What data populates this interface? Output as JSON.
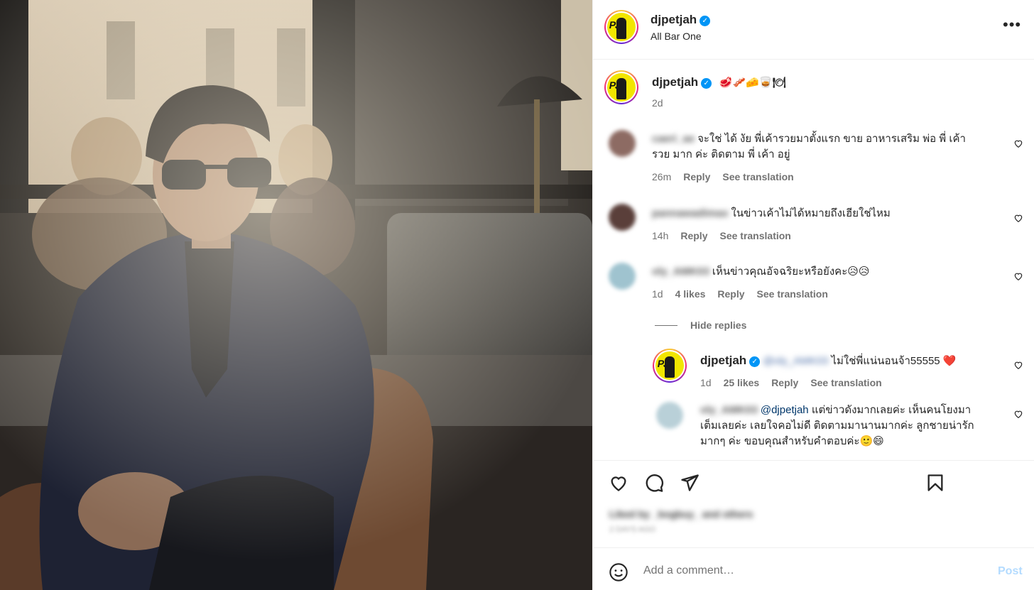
{
  "post": {
    "author": "djpetjah",
    "location": "All Bar One",
    "caption_emojis": "🥩🥓🧀🥃🍽",
    "caption_time": "2d"
  },
  "comments": [
    {
      "username_blurred": "caeri_ae",
      "text": "จะใช่ ได้ งัย พี่เค้ารวยมาตั้งแรก ขาย อาหารเสริม พ่อ พี่ เค้า",
      "text2": "รวย มาก ค่ะ ติดตาม พี่ เค้า อยู่",
      "time": "26m",
      "reply": "Reply",
      "translate": "See translation"
    },
    {
      "username_blurred": "pannawadimax",
      "text": "ในข่าวเค้าไม่ได้หมายถึงเฮียใช่ไหม",
      "time": "14h",
      "reply": "Reply",
      "translate": "See translation"
    },
    {
      "username_blurred": "oly_AMK03",
      "text": "เห็นข่าวคุณอัจฉริยะหรือยังคะ😥😥",
      "time": "1d",
      "likes": "4 likes",
      "reply": "Reply",
      "translate": "See translation"
    }
  ],
  "hide_replies": "Hide replies",
  "replies": [
    {
      "username": "djpetjah",
      "mention_blurred": "@oly_AMK03",
      "text": "ไม่ใช่พี่แน่นอนจ้า55555 ❤️",
      "time": "1d",
      "likes": "25 likes",
      "reply": "Reply",
      "translate": "See translation"
    },
    {
      "username_blurred": "oly_AMK03",
      "mention": "@djpetjah",
      "text": "แต่ข่าวดังมากเลยค่ะ เห็นคนโยงมา",
      "text2": "เต็มเลยค่ะ เลยใจคอไม่ดี ติดตามมานานมากค่ะ ลูกชายน่ารัก",
      "text3": "มากๆ ค่ะ ขอบคุณสำหรับคำตอบค่ะ🙂😄"
    }
  ],
  "likes_blurred": "Liked by _bogbuy_ and others",
  "date_blurred": "2 DAYS AGO",
  "add_comment": {
    "placeholder": "Add a comment…",
    "post_label": "Post"
  },
  "icons": {
    "verified": "verified-badge-icon",
    "like": "heart-icon",
    "comment": "comment-bubble-icon",
    "share": "paper-plane-icon",
    "save": "bookmark-icon",
    "emoji": "emoji-smiley-icon",
    "more": "more-options-icon"
  },
  "colors": {
    "verified": "#0095f6",
    "post_button": "#b3dbff",
    "meta_text": "#737373",
    "mention": "#00376b"
  }
}
